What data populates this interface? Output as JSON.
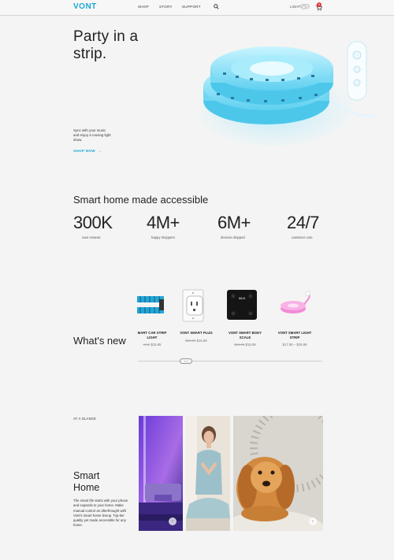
{
  "nav": {
    "logo": "VONT",
    "links": [
      "SHOP",
      "STORY",
      "SUPPORT"
    ],
    "light_label": "LIGHT",
    "cart_count": "0"
  },
  "hero": {
    "title_line1": "Party in a",
    "title_line2": "strip.",
    "text": "Sync with your music and enjoy a rousing light show.",
    "cta": "SHOP NOW"
  },
  "stats": {
    "title": "Smart home made accessible",
    "items": [
      {
        "value": "300K",
        "label": "rave reviews"
      },
      {
        "value": "4M+",
        "label": "happy shoppers"
      },
      {
        "value": "6M+",
        "label": "devices dropped"
      },
      {
        "value": "24/7",
        "label": "customer care"
      }
    ]
  },
  "products": {
    "title": "What's new",
    "items": [
      {
        "name": "MART CAR STRIP LIGHT",
        "old": "5.95",
        "price": "$15.95"
      },
      {
        "name": "VONT SMART PLUG",
        "old": "$19.95",
        "price": "$15.95"
      },
      {
        "name": "VONT SMART BODY SCALE",
        "old": "$24.95",
        "price": "$15.95"
      },
      {
        "name": "VONT SMART LIGHT STRIP",
        "old": "",
        "price": "$17.95 – $29.95"
      }
    ]
  },
  "glance": {
    "eyebrow": "AT A GLANCE",
    "title_line1": "Smart",
    "title_line2": "Home",
    "text": "The smart life starts with your phone and expands to your home. Make manual control an afterthought with Vont's smart home lineup. Top-tier quality yet made accessible for any home."
  },
  "colors": {
    "accent": "#1aa6d6",
    "badge": "#e4363c"
  }
}
